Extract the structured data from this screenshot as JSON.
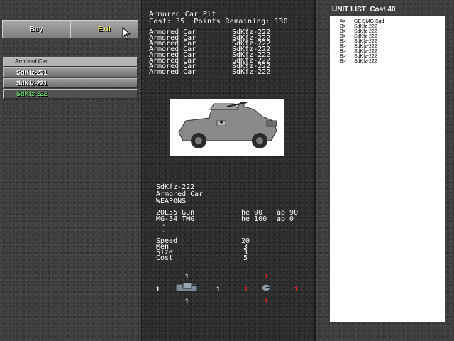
{
  "buttons": {
    "buy": "Buy",
    "exit": "Exit"
  },
  "type_list": {
    "header": "Armored Car",
    "items": [
      {
        "label": "SdKfz-231",
        "selected": false
      },
      {
        "label": "SdKfz-221",
        "selected": false
      },
      {
        "label": "SdKfz-222",
        "selected": true
      }
    ]
  },
  "platoon": {
    "title": "Armored Car Plt",
    "cost_line": "Cost: 35  Points Remaining: 130",
    "roster": [
      {
        "type": "Armored Car",
        "model": "SdKfz-222"
      },
      {
        "type": "Armored Car",
        "model": "SdKfz-222"
      },
      {
        "type": "Armored Car",
        "model": "SdKfz-222"
      },
      {
        "type": "Armored Car",
        "model": "SdKfz-222"
      },
      {
        "type": "Armored Car",
        "model": "SdKfz-222"
      },
      {
        "type": "Armored Car",
        "model": "SdKfz-222"
      },
      {
        "type": "Armored Car",
        "model": "SdKfz-222"
      },
      {
        "type": "Armored Car",
        "model": "SdKfz-222"
      }
    ]
  },
  "unit": {
    "name": "SdKfz-222",
    "class": "Armored Car",
    "weapons_header": "WEAPONS",
    "weapons": [
      {
        "name": "20L55 Gun",
        "he": "he 90",
        "ap": "ap 90"
      },
      {
        "name": "MG-34 TMG",
        "he": "he 100",
        "ap": "ap 0"
      },
      {
        "name": "-",
        "he": "",
        "ap": ""
      },
      {
        "name": "-",
        "he": "",
        "ap": ""
      }
    ],
    "stats": [
      {
        "label": "Speed",
        "value": "20"
      },
      {
        "label": "Men",
        "value": "3"
      },
      {
        "label": "Size",
        "value": "3"
      },
      {
        "label": "Cost",
        "value": "5"
      }
    ],
    "armor_hull": {
      "top": "1",
      "left": "1",
      "right": "1",
      "bottom": "1"
    },
    "armor_turret": {
      "top": "1",
      "left": "1",
      "right": "1",
      "bottom": "1"
    }
  },
  "unit_list": {
    "title": "UNIT LIST  Cost 40",
    "rows": [
      {
        "slot": "A>",
        "name": "GE SMG Sqd"
      },
      {
        "slot": "B>",
        "name": "SdKfz-222"
      },
      {
        "slot": "B>",
        "name": "SdKfz-222"
      },
      {
        "slot": "B>",
        "name": "SdKfz-222"
      },
      {
        "slot": "B>",
        "name": "SdKfz-222"
      },
      {
        "slot": "B>",
        "name": "SdKfz-222"
      },
      {
        "slot": "B>",
        "name": "SdKfz-222"
      },
      {
        "slot": "B>",
        "name": "SdKfz-222"
      },
      {
        "slot": "B>",
        "name": "SdKfz-222"
      }
    ]
  },
  "colors": {
    "selected_text": "#5fd35f",
    "exit_text": "#f0f070",
    "armor_red": "#ff2020"
  },
  "icons": {
    "cursor": "arrow-cursor-icon",
    "vehicle_image": "armored-car-image"
  }
}
